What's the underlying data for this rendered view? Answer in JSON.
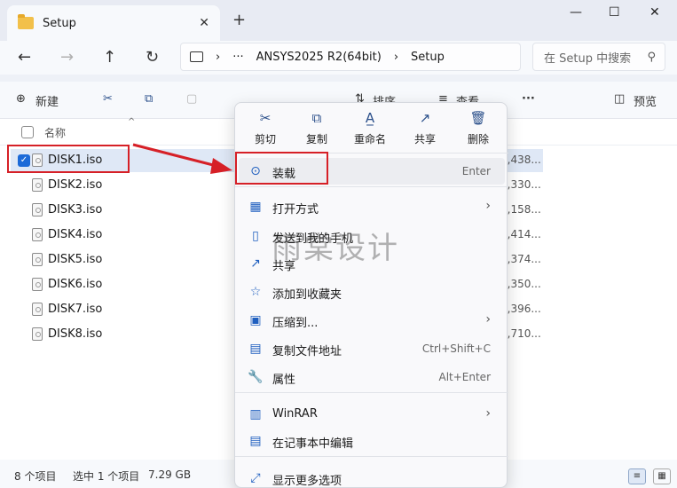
{
  "window": {
    "tab_title": "Setup",
    "close_tab": "✕",
    "new_tab": "+",
    "minimize": "—",
    "maximize": "☐",
    "close": "✕"
  },
  "nav": {
    "back": "←",
    "forward": "→",
    "up": "↑",
    "refresh": "↻"
  },
  "address": {
    "chevron": "›",
    "ellipsis": "···",
    "segments": [
      "ANSYS2025 R2(64bit)",
      "Setup"
    ]
  },
  "search": {
    "placeholder": "在 Setup 中搜索",
    "icon": "search-icon"
  },
  "toolbar": {
    "new_label": "新建",
    "cut": "✂",
    "copy": "⧉",
    "paste": "📋",
    "rename": "A",
    "share": "↗",
    "delete": "🗑",
    "sort_label": "排序",
    "view_label": "查看",
    "more": "···",
    "preview_label": "预览"
  },
  "filelist": {
    "header_name": "名称",
    "sort_arrow": "^",
    "files": [
      {
        "name": "DISK1.iso",
        "size": "4,438..."
      },
      {
        "name": "DISK2.iso",
        "size": "7,330..."
      },
      {
        "name": "DISK3.iso",
        "size": "0,158..."
      },
      {
        "name": "DISK4.iso",
        "size": "3,414..."
      },
      {
        "name": "DISK5.iso",
        "size": "3,374..."
      },
      {
        "name": "DISK6.iso",
        "size": "7,350..."
      },
      {
        "name": "DISK7.iso",
        "size": "7,396..."
      },
      {
        "name": "DISK8.iso",
        "size": "1,710..."
      }
    ]
  },
  "status": {
    "count": "8 个项目",
    "selected": "选中 1 个项目",
    "size": "7.29 GB"
  },
  "context_menu": {
    "quick_actions": [
      {
        "label": "剪切",
        "icon": "✂"
      },
      {
        "label": "复制",
        "icon": "⧉"
      },
      {
        "label": "重命名",
        "icon": "A̲"
      },
      {
        "label": "共享",
        "icon": "↗"
      },
      {
        "label": "删除",
        "icon": "🗑"
      }
    ],
    "items": [
      {
        "label": "装载",
        "shortcut": "Enter",
        "icon": "⊙"
      },
      {
        "label": "打开方式",
        "shortcut": "",
        "icon": "▦"
      },
      {
        "label": "发送到我的手机",
        "shortcut": "",
        "icon": "▯"
      },
      {
        "label": "共享",
        "shortcut": "",
        "icon": "↗"
      },
      {
        "label": "添加到收藏夹",
        "shortcut": "",
        "icon": "☆"
      },
      {
        "label": "压缩到...",
        "shortcut": "",
        "icon": "▣"
      },
      {
        "label": "复制文件地址",
        "shortcut": "Ctrl+Shift+C",
        "icon": "▤"
      },
      {
        "label": "属性",
        "shortcut": "Alt+Enter",
        "icon": "🔧"
      },
      {
        "label": "WinRAR",
        "shortcut": "",
        "icon": "▥"
      },
      {
        "label": "在记事本中编辑",
        "shortcut": "",
        "icon": "▤"
      },
      {
        "label": "显示更多选项",
        "shortcut": "",
        "icon": "⤢"
      }
    ],
    "chevron": "›"
  },
  "watermark": "雨棠设计",
  "colors": {
    "accent": "#1c6ad8",
    "highlight": "#d62027",
    "folder": "#f2c04a"
  }
}
